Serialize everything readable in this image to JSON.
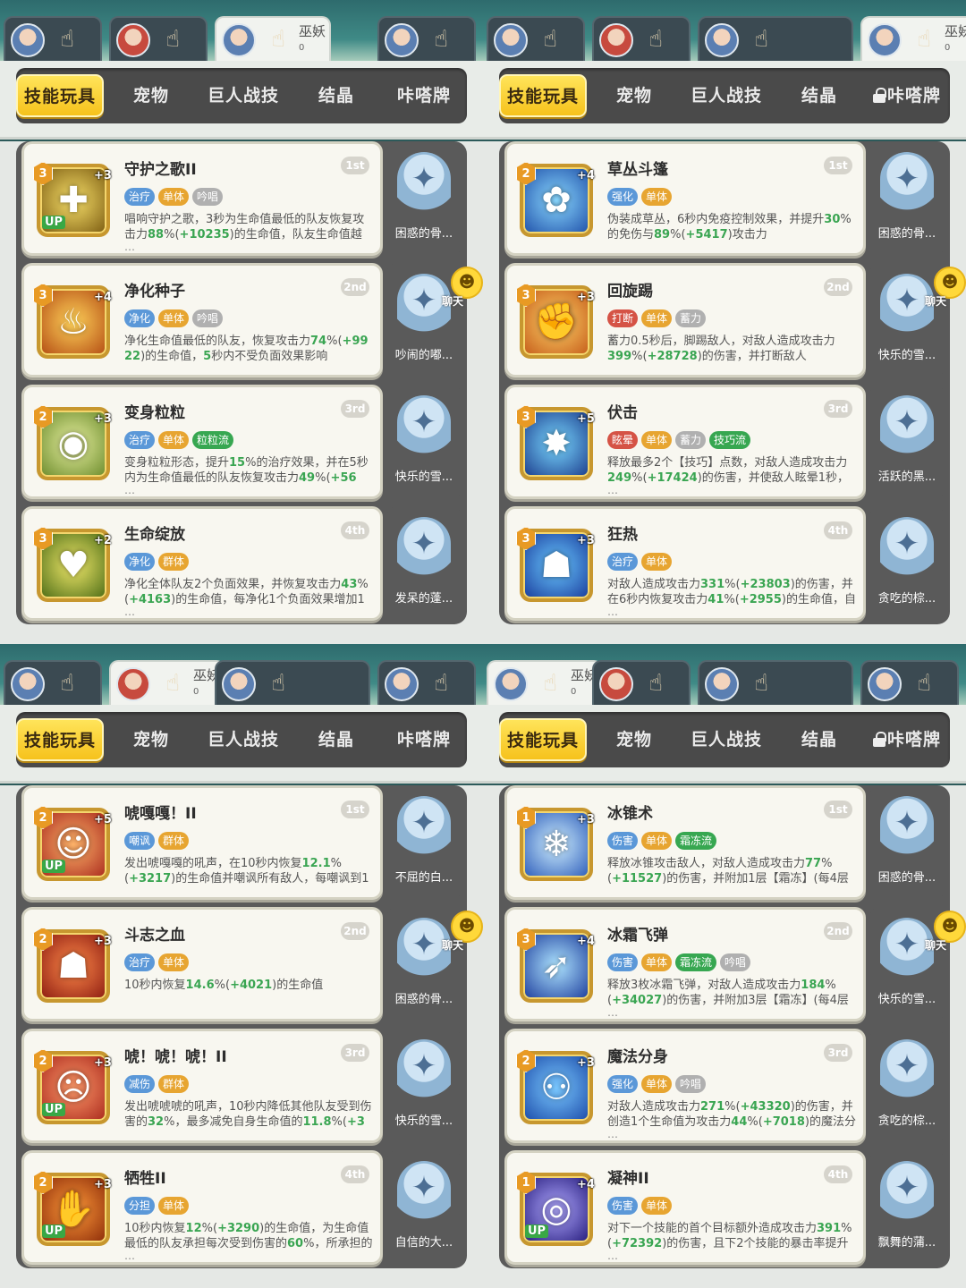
{
  "tabs": [
    "技能玩具",
    "宠物",
    "巨人战技",
    "结晶",
    "咔嗒牌"
  ],
  "hero_name": "巫妖",
  "hero_dots": "∞",
  "hero_sub": "0",
  "chat_label": "聊天",
  "colors": {
    "accent": "#f6c21c",
    "tag_blue": "#5b98d8",
    "tag_orange": "#e7a531",
    "tag_green": "#37a751",
    "tag_red": "#d55346",
    "value_green": "#3aa552"
  },
  "panels": [
    {
      "tab_lock": false,
      "cards": [
        {
          "name": "守护之歌II",
          "rank": "1st",
          "level": "3",
          "plus": "+3",
          "up": "UP",
          "icon": "shield-heal-icon",
          "tags": [
            {
              "t": "治疗",
              "c": "blue"
            },
            {
              "t": "单体",
              "c": "orange"
            },
            {
              "t": "吟唱",
              "c": "gray"
            }
          ],
          "desc": [
            {
              "t": "唱响守护之歌，3秒为生命值最低的队友恢复攻击力"
            },
            {
              "t": "88",
              "g": 1
            },
            {
              "t": "%("
            },
            {
              "t": "+10235",
              "g": 1
            },
            {
              "t": ")的生命值，队友生命值越"
            }
          ],
          "ellipsis": "…",
          "pet": "困惑的骨..."
        },
        {
          "name": "净化种子",
          "rank": "2nd",
          "level": "3",
          "plus": "+4",
          "up": "",
          "icon": "flame-drop-icon",
          "tags": [
            {
              "t": "净化",
              "c": "blue"
            },
            {
              "t": "单体",
              "c": "orange"
            },
            {
              "t": "吟唱",
              "c": "gray"
            }
          ],
          "desc": [
            {
              "t": "净化生命值最低的队友，恢复攻击力"
            },
            {
              "t": "74",
              "g": 1
            },
            {
              "t": "%("
            },
            {
              "t": "+99 22",
              "g": 1
            },
            {
              "t": ")的生命值，"
            },
            {
              "t": "5",
              "g": 1
            },
            {
              "t": "秒内不受负面效果影响"
            }
          ],
          "ellipsis": "",
          "pet": "吵闹的嘟...",
          "chat": true
        },
        {
          "name": "变身粒粒",
          "rank": "3rd",
          "level": "2",
          "plus": "+3",
          "up": "",
          "icon": "owl-icon",
          "tags": [
            {
              "t": "治疗",
              "c": "blue"
            },
            {
              "t": "单体",
              "c": "orange"
            },
            {
              "t": "粒粒流",
              "c": "green"
            }
          ],
          "desc": [
            {
              "t": "变身粒粒形态，提升"
            },
            {
              "t": "15",
              "g": 1
            },
            {
              "t": "%的治疗效果，并在5秒内为生命值最低的队友恢复攻击力"
            },
            {
              "t": "49",
              "g": 1
            },
            {
              "t": "%("
            },
            {
              "t": "+56",
              "g": 1
            }
          ],
          "ellipsis": "…",
          "pet": "快乐的雪..."
        },
        {
          "name": "生命绽放",
          "rank": "4th",
          "level": "3",
          "plus": "+2",
          "up": "",
          "icon": "heart-bloom-icon",
          "tags": [
            {
              "t": "净化",
              "c": "blue"
            },
            {
              "t": "群体",
              "c": "orange"
            }
          ],
          "desc": [
            {
              "t": "净化全体队友2个负面效果，并恢复攻击力"
            },
            {
              "t": "43",
              "g": 1
            },
            {
              "t": "%("
            },
            {
              "t": "+4163",
              "g": 1
            },
            {
              "t": ")的生命值，每净化1个负面效果增加1"
            }
          ],
          "ellipsis": "…",
          "pet": "发呆的蓬..."
        }
      ]
    },
    {
      "tab_lock": true,
      "cards": [
        {
          "name": "草丛斗篷",
          "rank": "1st",
          "level": "2",
          "plus": "+4",
          "up": "",
          "icon": "bush-icon",
          "tags": [
            {
              "t": "强化",
              "c": "blue"
            },
            {
              "t": "单体",
              "c": "orange"
            }
          ],
          "desc": [
            {
              "t": "伪装成草丛，6秒内免疫控制效果，并提升"
            },
            {
              "t": "30",
              "g": 1
            },
            {
              "t": "%的免伤与"
            },
            {
              "t": "89",
              "g": 1
            },
            {
              "t": "%("
            },
            {
              "t": "+5417",
              "g": 1
            },
            {
              "t": ")攻击力"
            }
          ],
          "ellipsis": "",
          "pet": "困惑的骨..."
        },
        {
          "name": "回旋踢",
          "rank": "2nd",
          "level": "3",
          "plus": "+3",
          "up": "",
          "icon": "kick-icon",
          "tags": [
            {
              "t": "打断",
              "c": "red"
            },
            {
              "t": "单体",
              "c": "orange"
            },
            {
              "t": "蓄力",
              "c": "gray"
            }
          ],
          "desc": [
            {
              "t": "蓄力0.5秒后，脚踢敌人，对敌人造成攻击力"
            },
            {
              "t": "399",
              "g": 1
            },
            {
              "t": "%("
            },
            {
              "t": "+28728",
              "g": 1
            },
            {
              "t": ")的伤害，并打断敌人"
            }
          ],
          "ellipsis": "",
          "pet": "快乐的雪...",
          "chat": true
        },
        {
          "name": "伏击",
          "rank": "3rd",
          "level": "3",
          "plus": "+5",
          "up": "",
          "icon": "ambush-icon",
          "tags": [
            {
              "t": "眩晕",
              "c": "red"
            },
            {
              "t": "单体",
              "c": "orange"
            },
            {
              "t": "蓄力",
              "c": "gray"
            },
            {
              "t": "技巧流",
              "c": "green"
            }
          ],
          "desc": [
            {
              "t": "释放最多2个【技巧】点数，对敌人造成攻击力"
            },
            {
              "t": "249",
              "g": 1
            },
            {
              "t": "%("
            },
            {
              "t": "+17424",
              "g": 1
            },
            {
              "t": ")的伤害，并使敌人眩晕1秒，"
            }
          ],
          "ellipsis": "…",
          "pet": "活跃的黑..."
        },
        {
          "name": "狂热",
          "rank": "4th",
          "level": "3",
          "plus": "+3",
          "up": "",
          "icon": "frenzy-icon",
          "tags": [
            {
              "t": "治疗",
              "c": "blue"
            },
            {
              "t": "单体",
              "c": "orange"
            }
          ],
          "desc": [
            {
              "t": "对敌人造成攻击力"
            },
            {
              "t": "331",
              "g": 1
            },
            {
              "t": "%("
            },
            {
              "t": "+23803",
              "g": 1
            },
            {
              "t": ")的伤害，并在6秒内恢复攻击力"
            },
            {
              "t": "41",
              "g": 1
            },
            {
              "t": "%("
            },
            {
              "t": "+2955",
              "g": 1
            },
            {
              "t": ")的生命值，自身"
            }
          ],
          "ellipsis": "…",
          "pet": "贪吃的棕..."
        }
      ]
    },
    {
      "tab_lock": false,
      "cards": [
        {
          "name": "唬嘎嘎！II",
          "rank": "1st",
          "level": "2",
          "plus": "+5",
          "up": "UP",
          "icon": "roar-icon",
          "tags": [
            {
              "t": "嘲讽",
              "c": "blue"
            },
            {
              "t": "群体",
              "c": "orange"
            }
          ],
          "desc": [
            {
              "t": "发出唬嘎嘎的吼声，在10秒内恢复"
            },
            {
              "t": "12.1",
              "g": 1
            },
            {
              "t": "%("
            },
            {
              "t": "+3217",
              "g": 1
            },
            {
              "t": ")的生命值并嘲讽所有敌人，每嘲讽到1个敌"
            }
          ],
          "ellipsis": "",
          "pet": "不屈的白..."
        },
        {
          "name": "斗志之血",
          "rank": "2nd",
          "level": "2",
          "plus": "+3",
          "up": "",
          "icon": "blood-icon",
          "tags": [
            {
              "t": "治疗",
              "c": "blue"
            },
            {
              "t": "单体",
              "c": "orange"
            }
          ],
          "desc": [
            {
              "t": "10秒内恢复"
            },
            {
              "t": "14.6",
              "g": 1
            },
            {
              "t": "%("
            },
            {
              "t": "+4021",
              "g": 1
            },
            {
              "t": ")的生命值"
            }
          ],
          "ellipsis": "",
          "pet": "困惑的骨...",
          "chat": true
        },
        {
          "name": "唬！唬！唬！II",
          "rank": "3rd",
          "level": "2",
          "plus": "+3",
          "up": "UP",
          "icon": "shout-icon",
          "tags": [
            {
              "t": "减伤",
              "c": "blue"
            },
            {
              "t": "群体",
              "c": "orange"
            }
          ],
          "desc": [
            {
              "t": "发出唬唬唬的吼声，10秒内降低其他队友受到伤害的"
            },
            {
              "t": "32",
              "g": 1
            },
            {
              "t": "%，最多减免自身生命值的"
            },
            {
              "t": "11.8",
              "g": 1
            },
            {
              "t": "%("
            },
            {
              "t": "+3",
              "g": 1
            }
          ],
          "ellipsis": "",
          "pet": "快乐的雪..."
        },
        {
          "name": "牺牲II",
          "rank": "4th",
          "level": "2",
          "plus": "+3",
          "up": "UP",
          "icon": "sacrifice-icon",
          "tags": [
            {
              "t": "分担",
              "c": "blue"
            },
            {
              "t": "单体",
              "c": "orange"
            }
          ],
          "desc": [
            {
              "t": "10秒内恢复"
            },
            {
              "t": "12",
              "g": 1
            },
            {
              "t": "%("
            },
            {
              "t": "+3290",
              "g": 1
            },
            {
              "t": ")的生命值，为生命值最低的队友承担每次受到伤害的"
            },
            {
              "t": "60",
              "g": 1
            },
            {
              "t": "%，所承担的"
            }
          ],
          "ellipsis": "…",
          "pet": "自信的大..."
        }
      ]
    },
    {
      "tab_lock": true,
      "cards": [
        {
          "name": "冰锥术",
          "rank": "1st",
          "level": "1",
          "plus": "+3",
          "up": "",
          "icon": "ice-spike-icon",
          "tags": [
            {
              "t": "伤害",
              "c": "blue"
            },
            {
              "t": "单体",
              "c": "orange"
            },
            {
              "t": "霜冻流",
              "c": "green"
            }
          ],
          "desc": [
            {
              "t": "释放冰锥攻击敌人，对敌人造成攻击力"
            },
            {
              "t": "77",
              "g": 1
            },
            {
              "t": "%("
            },
            {
              "t": "+11527",
              "g": 1
            },
            {
              "t": ")的伤害，并附加1层【霜冻】(每4层【霜"
            }
          ],
          "ellipsis": "",
          "pet": "困惑的骨..."
        },
        {
          "name": "冰霜飞弹",
          "rank": "2nd",
          "level": "3",
          "plus": "+4",
          "up": "",
          "icon": "frost-missile-icon",
          "tags": [
            {
              "t": "伤害",
              "c": "blue"
            },
            {
              "t": "单体",
              "c": "orange"
            },
            {
              "t": "霜冻流",
              "c": "green"
            },
            {
              "t": "吟唱",
              "c": "gray"
            }
          ],
          "desc": [
            {
              "t": "释放3枚冰霜飞弹，对敌人造成攻击力"
            },
            {
              "t": "184",
              "g": 1
            },
            {
              "t": "%("
            },
            {
              "t": "+34027",
              "g": 1
            },
            {
              "t": ")的伤害，并附加3层【霜冻】(每4层【"
            }
          ],
          "ellipsis": "…",
          "pet": "快乐的雪...",
          "chat": true
        },
        {
          "name": "魔法分身",
          "rank": "3rd",
          "level": "2",
          "plus": "+3",
          "up": "",
          "icon": "clone-icon",
          "tags": [
            {
              "t": "强化",
              "c": "blue"
            },
            {
              "t": "单体",
              "c": "orange"
            },
            {
              "t": "吟唱",
              "c": "gray"
            }
          ],
          "desc": [
            {
              "t": "对敌人造成攻击力"
            },
            {
              "t": "271",
              "g": 1
            },
            {
              "t": "%("
            },
            {
              "t": "+43320",
              "g": 1
            },
            {
              "t": ")的伤害，并创造1个生命值为攻击力"
            },
            {
              "t": "44",
              "g": 1
            },
            {
              "t": "%("
            },
            {
              "t": "+7018",
              "g": 1
            },
            {
              "t": ")的魔法分身"
            }
          ],
          "ellipsis": "…",
          "pet": "贪吃的棕..."
        },
        {
          "name": "凝神II",
          "rank": "4th",
          "level": "1",
          "plus": "+4",
          "up": "UP",
          "icon": "focus-eye-icon",
          "tags": [
            {
              "t": "伤害",
              "c": "blue"
            },
            {
              "t": "单体",
              "c": "orange"
            }
          ],
          "desc": [
            {
              "t": "对下一个技能的首个目标额外造成攻击力"
            },
            {
              "t": "391",
              "g": 1
            },
            {
              "t": "%("
            },
            {
              "t": "+72392",
              "g": 1
            },
            {
              "t": ")的伤害，且下2个技能的暴击率提升"
            }
          ],
          "ellipsis": "…",
          "pet": "飘舞的蒲..."
        }
      ]
    }
  ]
}
